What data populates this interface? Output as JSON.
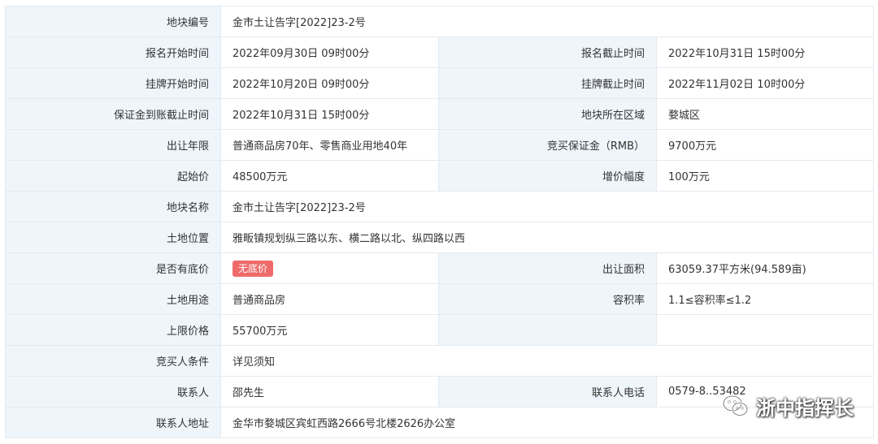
{
  "rows": {
    "r1": {
      "l1": "地块编号",
      "v1": "金市土让告字[2022]23-2号"
    },
    "r2": {
      "l1": "报名开始时间",
      "v1": "2022年09月30日 09时00分",
      "l2": "报名截止时间",
      "v2": "2022年10月31日 15时00分"
    },
    "r3": {
      "l1": "挂牌开始时间",
      "v1": "2022年10月20日 09时00分",
      "l2": "挂牌截止时间",
      "v2": "2022年11月02日 10时00分"
    },
    "r4": {
      "l1": "保证金到账截止时间",
      "v1": "2022年10月31日 15时00分",
      "l2": "地块所在区域",
      "v2": "婺城区"
    },
    "r5": {
      "l1": "出让年限",
      "v1": "普通商品房70年、零售商业用地40年",
      "l2": "竞买保证金（RMB）",
      "v2": "9700万元"
    },
    "r6": {
      "l1": "起始价",
      "v1": "48500万元",
      "l2": "增价幅度",
      "v2": "100万元"
    },
    "r7": {
      "l1": "地块名称",
      "v1": "金市土让告字[2022]23-2号"
    },
    "r8": {
      "l1": "土地位置",
      "v1": "雅畈镇规划纵三路以东、横二路以北、纵四路以西"
    },
    "r9": {
      "l1": "是否有底价",
      "badge": "无底价",
      "l2": "出让面积",
      "v2": "63059.37平方米(94.589亩)"
    },
    "r10": {
      "l1": "土地用途",
      "v1": "普通商品房",
      "l2": "容积率",
      "v2": "1.1≤容积率≤1.2"
    },
    "r11": {
      "l1": "上限价格",
      "v1": "55700万元",
      "l2": "",
      "v2": ""
    },
    "r12": {
      "l1": "竞买人条件",
      "v1": "详见须知"
    },
    "r13": {
      "l1": "联系人",
      "v1": "邵先生",
      "l2": "联系人电话",
      "v2": "0579-8..53482"
    },
    "r14": {
      "l1": "联系人地址",
      "v1": "金华市婺城区宾虹西路2666号北楼2626办公室"
    }
  },
  "watermark": {
    "text": "浙中指挥长",
    "icon": "wechat-icon"
  },
  "colors": {
    "label_bg": "#eef5fb",
    "border": "#e4eaf0",
    "badge": "#ef6b6b"
  }
}
